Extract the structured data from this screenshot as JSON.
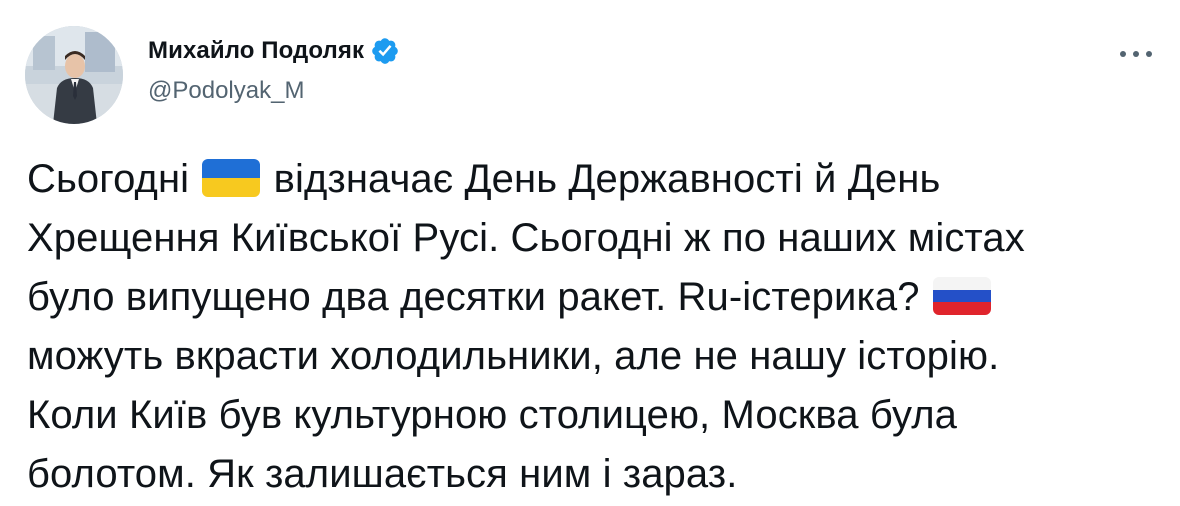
{
  "author": {
    "display_name": "Михайло Подоляк",
    "handle": "@Podolyak_M",
    "verified": true,
    "verified_color": "#1d9bf0"
  },
  "tweet": {
    "line1_before_flag": "Сьогодні ",
    "flag1": "ukraine-flag-icon",
    "line1_after_flag": " відзначає День Державності й День",
    "line2": "Хрещення Київської Русі. Сьогодні ж по наших містах",
    "line3_before_flag": "було випущено два десятки ракет. Ru-істерика? ",
    "flag2": "russia-flag-icon",
    "line4": "можуть вкрасти холодильники, але не нашу історію.",
    "line5": "Коли Київ був культурною столицею, Москва була",
    "line6": "болотом. Як залишається ним і зараз."
  },
  "colors": {
    "text": "#0f1419",
    "secondary_text": "#536471",
    "background": "#ffffff"
  },
  "icons": {
    "more": "more-options-icon",
    "verified": "verified-badge-icon"
  }
}
